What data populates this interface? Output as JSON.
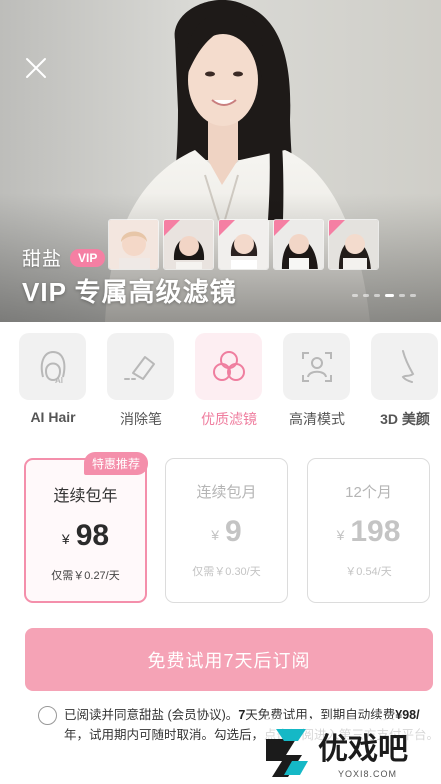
{
  "hero": {
    "brand_name": "甜盐",
    "vip_badge": "VIP",
    "title": "VIP 专属高级滤镜",
    "carousel_dots": 6,
    "active_dot": 4
  },
  "features": [
    {
      "label": "AI Hair",
      "icon": "ai-hair-icon",
      "active": false
    },
    {
      "label": "消除笔",
      "icon": "eraser-icon",
      "active": false
    },
    {
      "label": "优质滤镜",
      "icon": "filter-circles-icon",
      "active": true
    },
    {
      "label": "高清模式",
      "icon": "hd-face-scan-icon",
      "active": false
    },
    {
      "label": "3D 美颜",
      "icon": "nose-profile-icon",
      "active": false
    }
  ],
  "plans": [
    {
      "name": "连续包年",
      "currency": "¥",
      "price": "98",
      "per": "仅需￥0.27/天",
      "selected": true
    },
    {
      "name": "连续包月",
      "currency": "¥",
      "price": "9",
      "per": "仅需￥0.30/天",
      "selected": false
    },
    {
      "name": "12个月",
      "currency": "¥",
      "price": "198",
      "per": "￥0.54/天",
      "selected": false
    }
  ],
  "promo_tag": "特惠推荐",
  "cta_label": "免费试用7天后订阅",
  "agreement": {
    "part1": "已阅读并同意甜盐 (会员协议)。",
    "bold": "7",
    "part2": "天免费试用，到期自动续费",
    "bold2": "¥98/",
    "part3": "年，试用期内可随时取消。勾选后，点击订阅进入第三方支付平台。"
  },
  "watermark": {
    "text": "优戏吧",
    "url": "YOXI8.COM"
  },
  "colors": {
    "accent": "#f48fab",
    "cta": "#f5a3b6",
    "badge": "#f57fa3"
  }
}
